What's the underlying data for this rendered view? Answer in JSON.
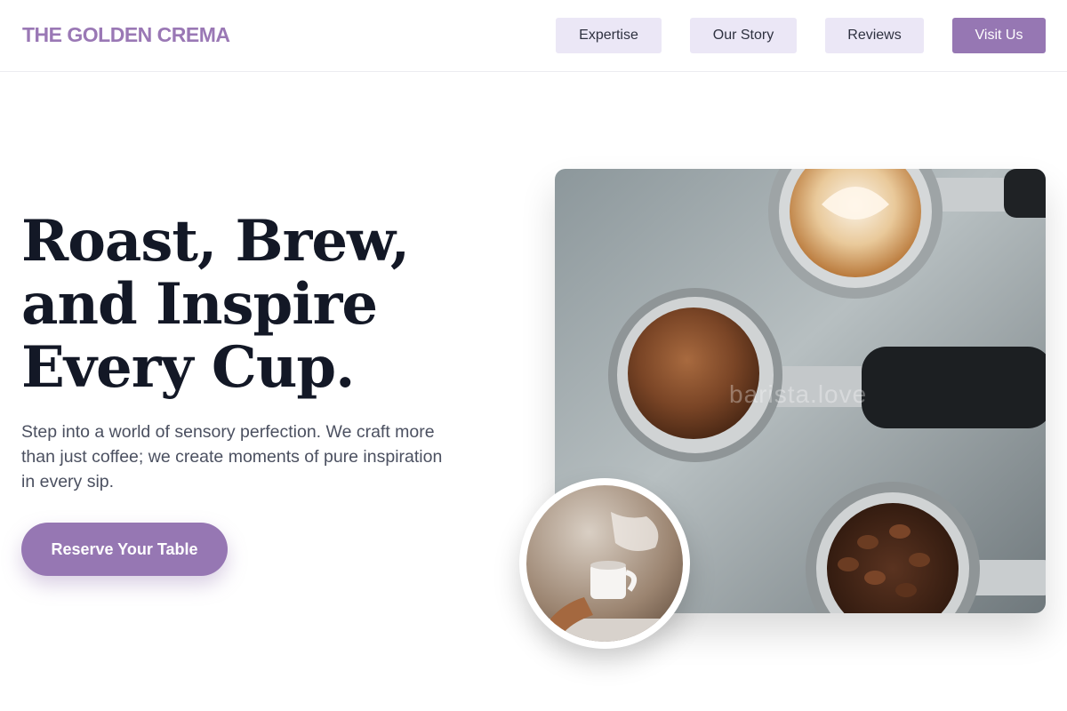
{
  "brand": {
    "name": "THE GOLDEN CREMA"
  },
  "nav": {
    "items": [
      {
        "label": "Expertise"
      },
      {
        "label": "Our Story"
      },
      {
        "label": "Reviews"
      },
      {
        "label": "Visit Us"
      }
    ]
  },
  "hero": {
    "title_lines": [
      "Roast, Brew,",
      "and Inspire",
      "Every Cup."
    ],
    "subtitle": "Step into a world of sensory perfection. We craft more than just coffee; we create moments of pure inspiration in every sip.",
    "cta_label": "Reserve Your Table"
  },
  "images": {
    "main": {
      "watermark": "barista.love",
      "subject": "portafilters with latte, ground coffee and beans"
    },
    "inset": {
      "subject": "hand holding steaming coffee cup"
    }
  },
  "colors": {
    "accent": "#9677b3",
    "nav_bg": "#ebe7f6",
    "heading": "#131826",
    "body_text": "#4b5060"
  }
}
